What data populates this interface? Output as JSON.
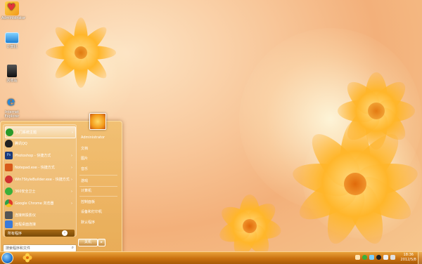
{
  "desktop": {
    "icons": [
      {
        "name": "Administrator",
        "icon": "heart-folder-icon",
        "color": "#e2323a"
      },
      {
        "name": "计算机",
        "icon": "computer-icon",
        "color": "#3aa0e8"
      },
      {
        "name": "回收站",
        "icon": "recycle-bin-icon",
        "color": "#333333"
      },
      {
        "name": "Internet Explorer",
        "icon": "ie-icon",
        "color": "#2a8ad8"
      }
    ]
  },
  "start_menu": {
    "programs": [
      {
        "label": "入门系统主题",
        "icon": "getting-started-icon",
        "color": "#2a9a2a",
        "arrow": "›"
      },
      {
        "label": "腾讯QQ",
        "icon": "qq-icon",
        "color": "#222222",
        "arrow": ""
      },
      {
        "label": "Photoshop - 快捷方式",
        "icon": "photoshop-icon",
        "color": "#1a3a7a",
        "arrow": "›"
      },
      {
        "label": "Notepad.exe - 快捷方式",
        "icon": "notepad-icon",
        "color": "#d85a1a",
        "arrow": "›"
      },
      {
        "label": "Win7StyleBuilder.exe - 快捷方式",
        "icon": "style-builder-icon",
        "color": "#d03030",
        "arrow": "›"
      },
      {
        "label": "360安全卫士",
        "icon": "360-security-icon",
        "color": "#3ab03a",
        "arrow": "›"
      },
      {
        "label": "Google Chrome 浏览器",
        "icon": "chrome-icon",
        "color": "#e0a020",
        "arrow": "›"
      },
      {
        "label": "连接到投影仪",
        "icon": "projector-icon",
        "color": "#555555",
        "arrow": ""
      },
      {
        "label": "远程桌面连接",
        "icon": "remote-desktop-icon",
        "color": "#3a7ad8",
        "arrow": ""
      }
    ],
    "all_programs": "所有程序",
    "search_placeholder": "搜索程序和文件",
    "right_items": [
      "Administrator",
      "文档",
      "图片",
      "音乐",
      "游戏",
      "计算机",
      "控制面板",
      "设备和打印机",
      "默认程序"
    ],
    "shutdown": "关机",
    "shutdown_arrow": "▸"
  },
  "taskbar": {
    "clock_time": "18:36",
    "clock_date": "2012/5/8"
  }
}
